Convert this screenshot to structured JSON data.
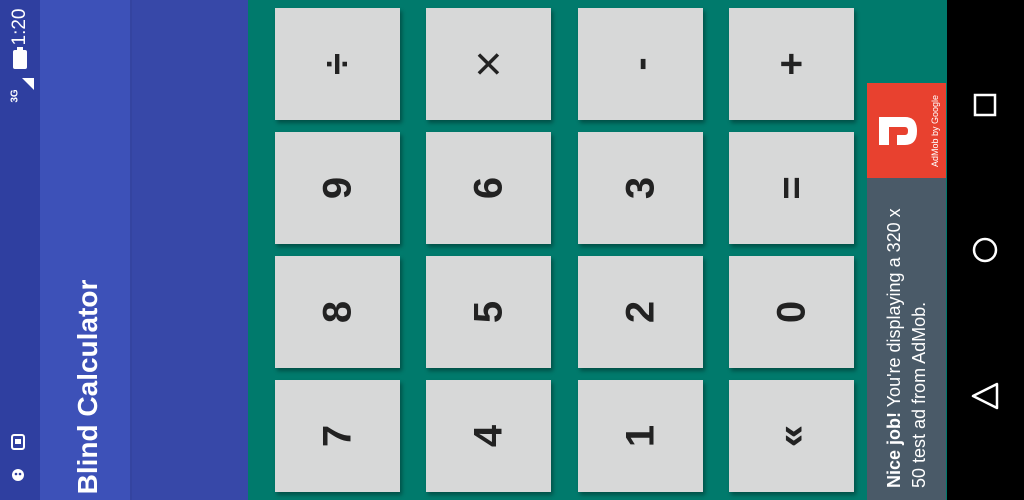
{
  "status_bar": {
    "time": "1:20",
    "network": "3G"
  },
  "app_bar": {
    "title": "Blind Calculator"
  },
  "keypad": {
    "keys": [
      {
        "label": "÷",
        "name": "divide"
      },
      {
        "label": "×",
        "name": "multiply"
      },
      {
        "label": "-",
        "name": "minus"
      },
      {
        "label": "+",
        "name": "plus"
      },
      {
        "label": "9",
        "name": "9"
      },
      {
        "label": "6",
        "name": "6"
      },
      {
        "label": "3",
        "name": "3"
      },
      {
        "label": "=",
        "name": "equals"
      },
      {
        "label": "8",
        "name": "8"
      },
      {
        "label": "5",
        "name": "5"
      },
      {
        "label": "2",
        "name": "2"
      },
      {
        "label": "0",
        "name": "0"
      },
      {
        "label": "7",
        "name": "7"
      },
      {
        "label": "4",
        "name": "4"
      },
      {
        "label": "1",
        "name": "1"
      },
      {
        "label": "«",
        "name": "backspace"
      }
    ]
  },
  "ad": {
    "brand": "AdMob by Google",
    "headline": "Nice job!",
    "body": "You're displaying a 320 x 50 test ad from AdMob."
  },
  "nav_bar": {
    "icons": [
      "recent-apps-icon",
      "home-icon",
      "back-icon"
    ]
  },
  "colors": {
    "status_bar": "#2f3fa0",
    "app_bar": "#3d51b8",
    "background": "#007a6c",
    "key": "#d7d8d8",
    "ad_logo": "#e8412f"
  }
}
